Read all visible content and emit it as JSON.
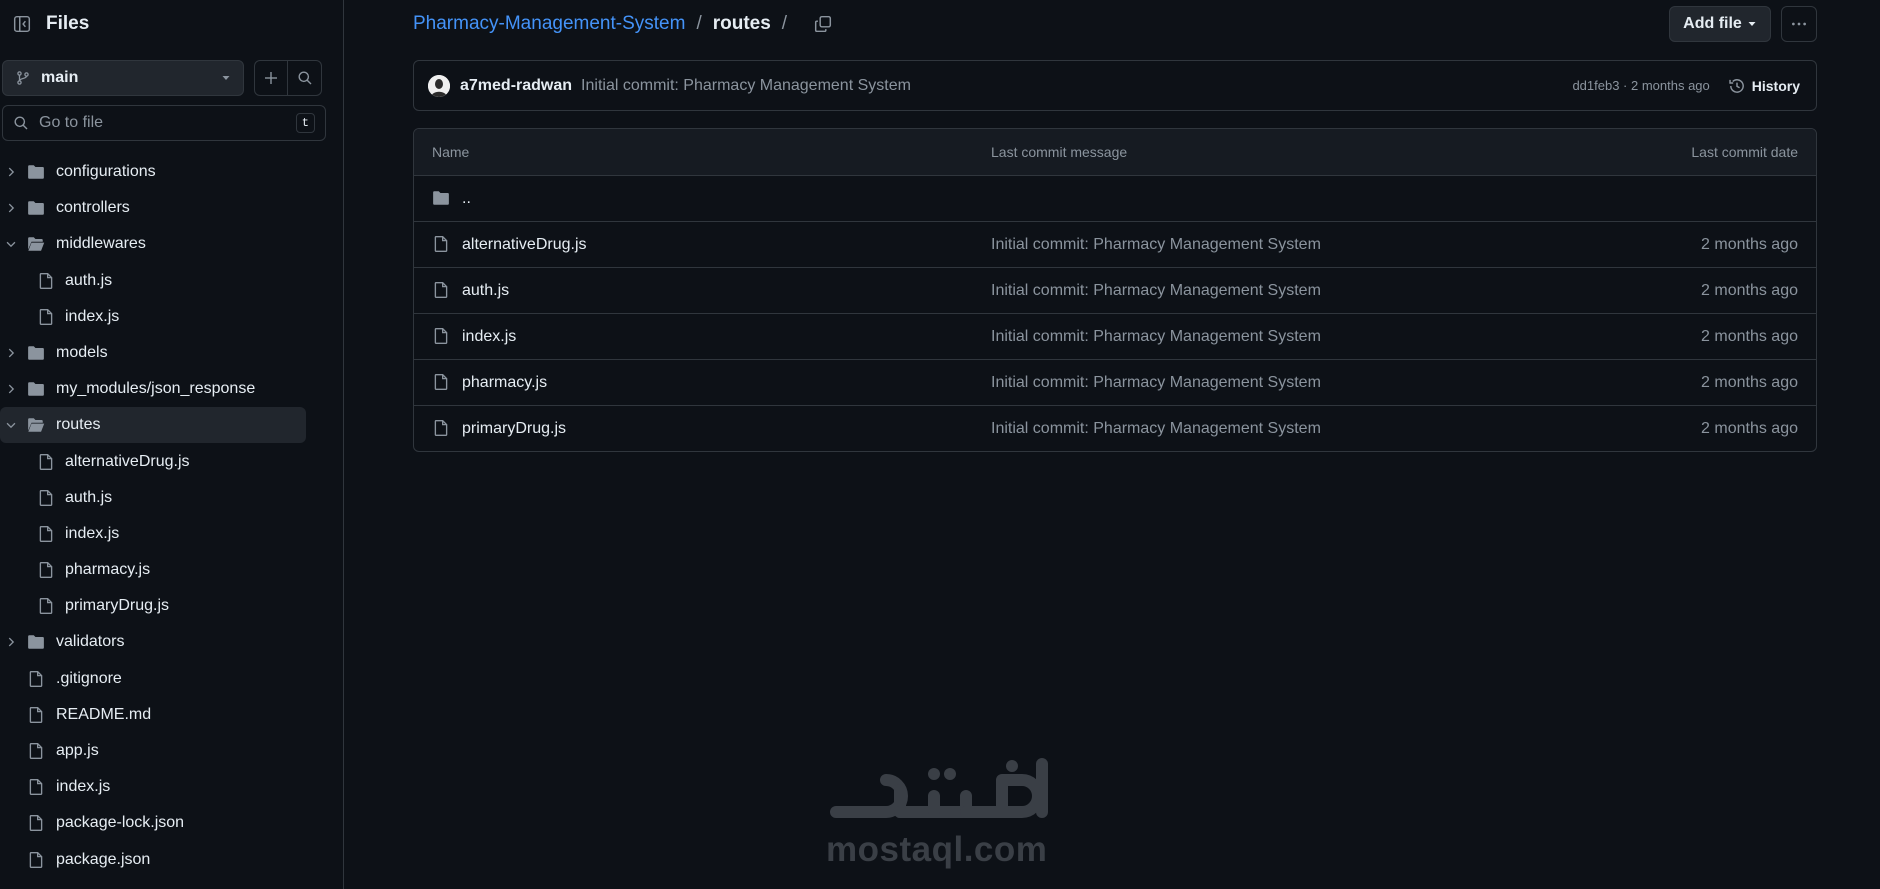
{
  "sidebar": {
    "title": "Files",
    "branch": "main",
    "goto_placeholder": "Go to file",
    "goto_shortcut": "t",
    "tree": [
      {
        "label": "configurations",
        "type": "folder",
        "expanded": false,
        "depth": 0
      },
      {
        "label": "controllers",
        "type": "folder",
        "expanded": false,
        "depth": 0
      },
      {
        "label": "middlewares",
        "type": "folder",
        "expanded": true,
        "depth": 0
      },
      {
        "label": "auth.js",
        "type": "file",
        "depth": 1
      },
      {
        "label": "index.js",
        "type": "file",
        "depth": 1
      },
      {
        "label": "models",
        "type": "folder",
        "expanded": false,
        "depth": 0
      },
      {
        "label": "my_modules/json_response",
        "type": "folder",
        "expanded": false,
        "depth": 0
      },
      {
        "label": "routes",
        "type": "folder",
        "expanded": true,
        "depth": 0,
        "active": true
      },
      {
        "label": "alternativeDrug.js",
        "type": "file",
        "depth": 1
      },
      {
        "label": "auth.js",
        "type": "file",
        "depth": 1
      },
      {
        "label": "index.js",
        "type": "file",
        "depth": 1
      },
      {
        "label": "pharmacy.js",
        "type": "file",
        "depth": 1
      },
      {
        "label": "primaryDrug.js",
        "type": "file",
        "depth": 1
      },
      {
        "label": "validators",
        "type": "folder",
        "expanded": false,
        "depth": 0
      },
      {
        "label": ".gitignore",
        "type": "file",
        "depth": 0
      },
      {
        "label": "README.md",
        "type": "file",
        "depth": 0
      },
      {
        "label": "app.js",
        "type": "file",
        "depth": 0
      },
      {
        "label": "index.js",
        "type": "file",
        "depth": 0
      },
      {
        "label": "package-lock.json",
        "type": "file",
        "depth": 0
      },
      {
        "label": "package.json",
        "type": "file",
        "depth": 0
      }
    ]
  },
  "breadcrumb": {
    "repo": "Pharmacy-Management-System",
    "sep1": "/",
    "current": "routes",
    "sep2": "/"
  },
  "toolbar": {
    "add_file": "Add file"
  },
  "commit": {
    "author": "a7med-radwan",
    "message": "Initial commit: Pharmacy Management System",
    "hash_age": "dd1feb3 · 2 months ago",
    "history": "History"
  },
  "table": {
    "headers": {
      "name": "Name",
      "message": "Last commit message",
      "date": "Last commit date"
    },
    "parent": "..",
    "rows": [
      {
        "name": "alternativeDrug.js",
        "message": "Initial commit: Pharmacy Management System",
        "date": "2 months ago"
      },
      {
        "name": "auth.js",
        "message": "Initial commit: Pharmacy Management System",
        "date": "2 months ago"
      },
      {
        "name": "index.js",
        "message": "Initial commit: Pharmacy Management System",
        "date": "2 months ago"
      },
      {
        "name": "pharmacy.js",
        "message": "Initial commit: Pharmacy Management System",
        "date": "2 months ago"
      },
      {
        "name": "primaryDrug.js",
        "message": "Initial commit: Pharmacy Management System",
        "date": "2 months ago"
      }
    ]
  },
  "watermark": {
    "latin": "mostaql.com",
    "arabic": "مستقل"
  },
  "colors": {
    "background": "#0d1117",
    "link": "#4493f8",
    "muted": "#8b949e",
    "border": "#30363d"
  }
}
